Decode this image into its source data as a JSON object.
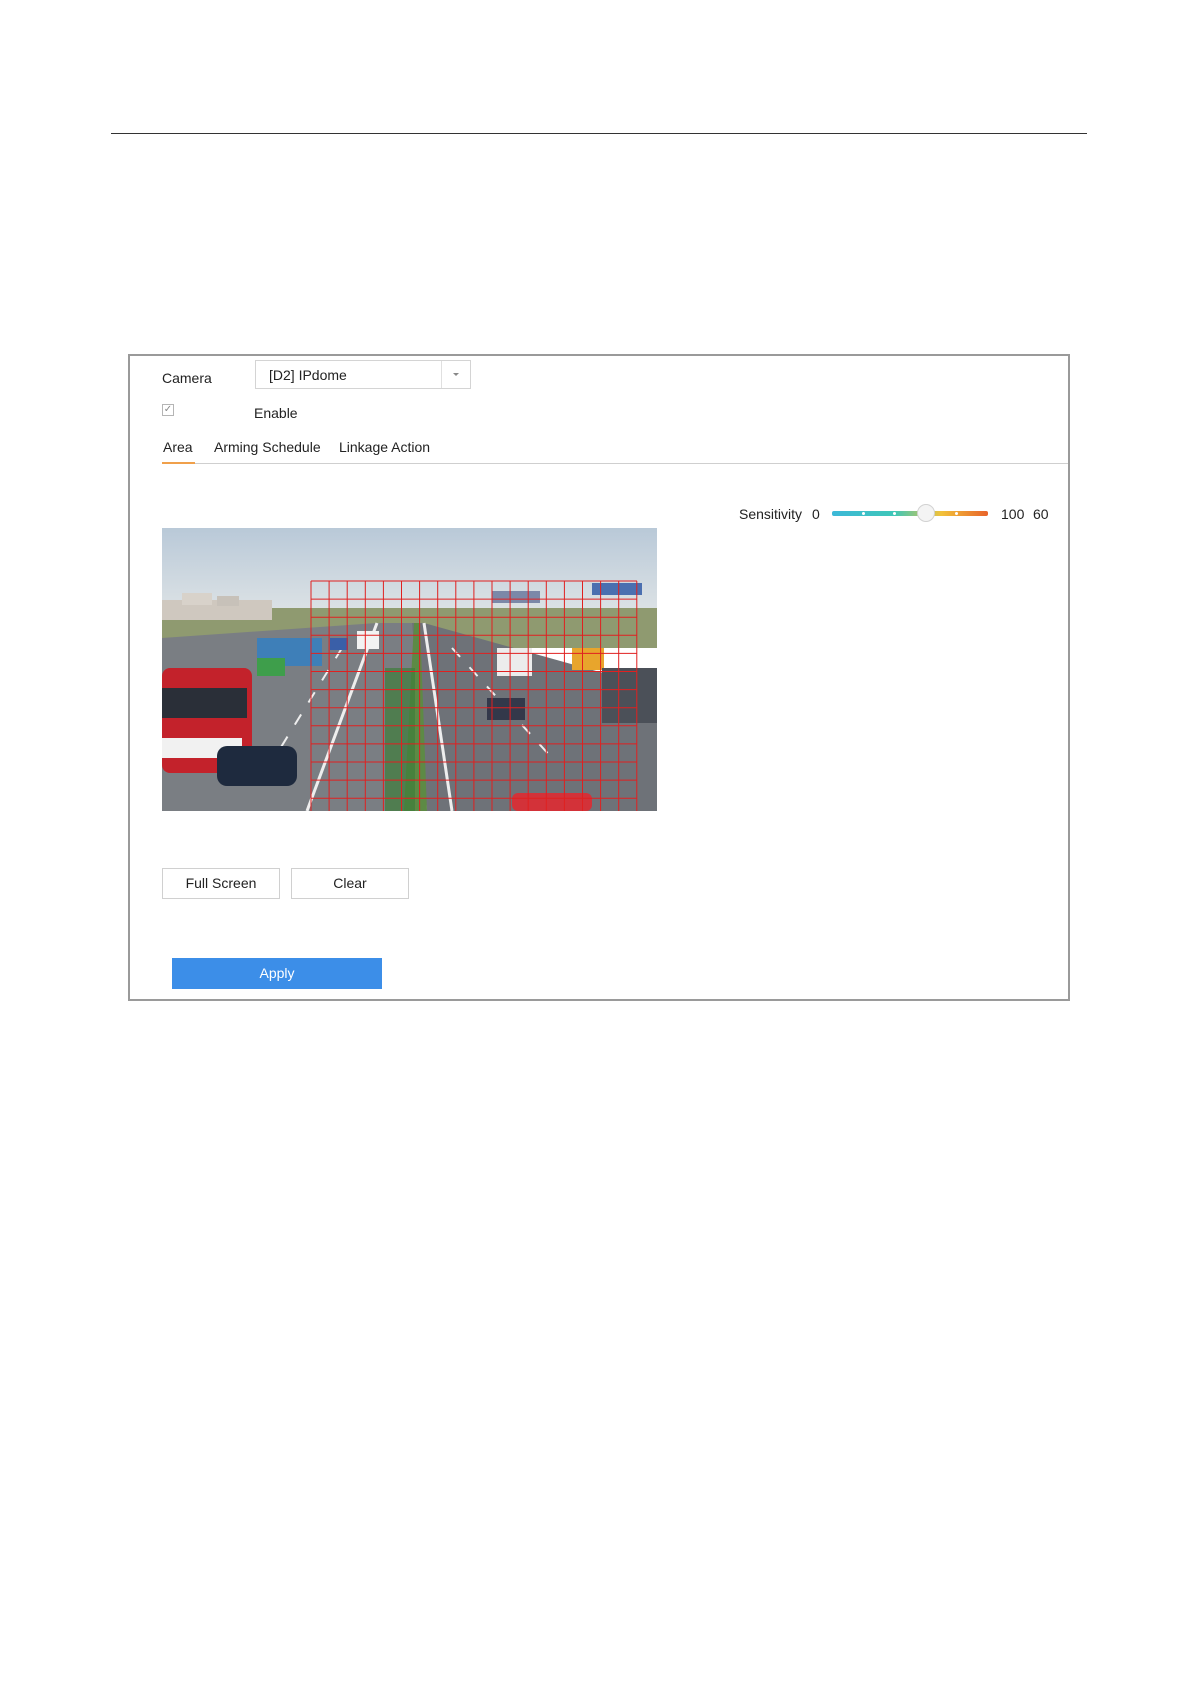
{
  "camera": {
    "label": "Camera",
    "selected": "[D2] IPdome"
  },
  "enable": {
    "label": "Enable",
    "checked": true,
    "check_mark": "✓"
  },
  "tabs": [
    {
      "label": "Area",
      "active": true
    },
    {
      "label": "Arming Schedule",
      "active": false
    },
    {
      "label": "Linkage Action",
      "active": false
    }
  ],
  "sensitivity": {
    "label": "Sensitivity",
    "min_label": "0",
    "max_label": "100",
    "value_label": "60",
    "value": 60,
    "min": 0,
    "max": 100
  },
  "buttons": {
    "full_screen": "Full Screen",
    "clear": "Clear",
    "apply": "Apply"
  },
  "colors": {
    "accent": "#3c8ee8",
    "tab_underline": "#f0a04b",
    "grid": "#e02020"
  },
  "icons": {
    "dropdown": "chevron-down-icon",
    "checkbox": "checkmark-icon"
  }
}
